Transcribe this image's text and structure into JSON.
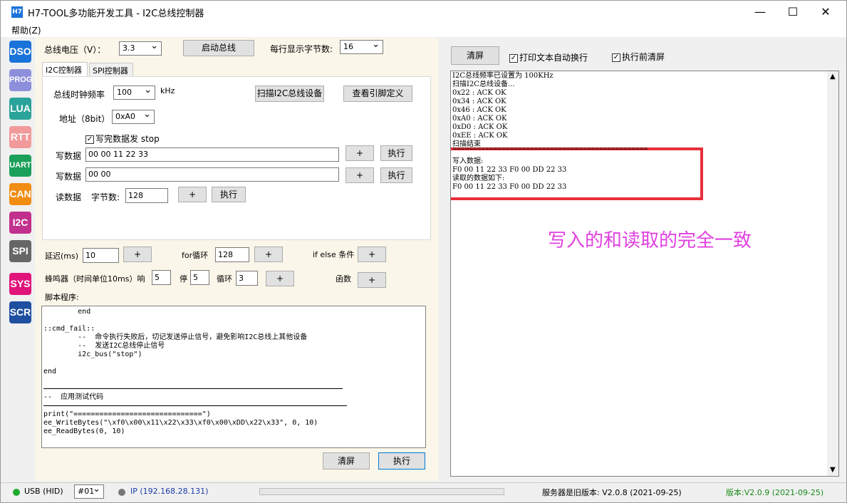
{
  "window": {
    "title": "H7-TOOL多功能开发工具 - I2C总线控制器",
    "icon": "H7",
    "minimize": "—",
    "maximize": "☐",
    "close": "✕"
  },
  "menu": {
    "help": "帮助(Z)"
  },
  "sidebar": [
    "DSO",
    "PROG",
    "LUA",
    "RTT",
    "UART",
    "CAN",
    "I2C",
    "SPI",
    "SYS",
    "SCR"
  ],
  "sidebar_colors": [
    "#1a73d9",
    "#8e8fdb",
    "#2aa39a",
    "#f29a9a",
    "#1aa05a",
    "#f08c12",
    "#c2308d",
    "#666666",
    "#e0147a",
    "#1f4fa0"
  ],
  "top": {
    "voltage_label": "总线电压（V）：",
    "voltage_value": "3.3",
    "start_bus": "启动总线",
    "bytes_per_line_label": "每行显示字节数:",
    "bytes_per_line_value": "16"
  },
  "tabs": [
    "I2C控制器",
    "SPI控制器"
  ],
  "i2c": {
    "clock_label": "总线时钟频率",
    "clock_value": "100",
    "clock_unit": "kHz",
    "scan": "扫描I2C总线设备",
    "pin_def": "查看引脚定义",
    "addr_label": "地址（8bit）",
    "addr_value": "0xA0",
    "stop_label": "写完数据发 stop",
    "stop_check": "✓",
    "write_label": "写数据",
    "write1": "00 00 11 22 33",
    "write2": "00 00",
    "plus": "+",
    "exec": "执行",
    "read_label": "读数据",
    "byte_count_label": "字节数:",
    "byte_count": "128"
  },
  "script_tools": {
    "delay_label": "延迟(ms)",
    "delay_value": "10",
    "for_label": "for循环",
    "for_value": "128",
    "ifelse_label": "if else 条件",
    "buzzer_label": "蜂鸣器（时间单位10ms）响",
    "buzzer_on": "5",
    "stop_label": "停",
    "buzzer_off": "5",
    "loop_label": "循环",
    "loop_value": "3",
    "func_label": "函数",
    "script_label": "脚本程序:"
  },
  "script_lines": [
    "        end",
    "",
    "::cmd_fail::",
    "        --  命令执行失败后，切记发送停止信号，避免影响I2C总线上其他设备",
    "        --  发送I2C总线停止信号",
    "        i2c_bus(\"stop\")",
    "",
    "end",
    "",
    "",
    "--  应用测试代码",
    "",
    "print(\"==============================\")",
    "ee_WriteBytes(\"\\xf0\\x00\\x11\\x22\\x33\\xf0\\x00\\xDD\\x22\\x33\", 0, 10)",
    "ee_ReadBytes(0, 10)"
  ],
  "script_buttons": {
    "clear": "清屏",
    "exec": "执行"
  },
  "right": {
    "clear": "清屏",
    "wrap_label": "打印文本自动换行",
    "clear_before_label": "执行前清屏",
    "check": "✓"
  },
  "output_lines": [
    "I2C总线频率已设置为 100KHz",
    "扫描I2C总线设备...",
    "0x22 : ACK OK",
    "0x34 : ACK OK",
    "0x46 : ACK OK",
    "0xA0 : ACK OK",
    "0xD0 : ACK OK",
    "0xEE : ACK OK",
    "扫描结束",
    "================================================",
    "写入数据:",
    "F0 00 11 22 33 F0 00 DD 22 33",
    "读取的数据如下:",
    "F0 00 11 22 33 F0 00 DD 22 33"
  ],
  "annotation": "写入的和读取的完全一致",
  "status": {
    "usb": "USB (HID)",
    "device": "#01",
    "ip": "IP (192.168.28.131)",
    "server": "服务器是旧版本: V2.0.8 (2021-09-25)",
    "version": "版本:V2.0.9 (2021-09-25)"
  }
}
